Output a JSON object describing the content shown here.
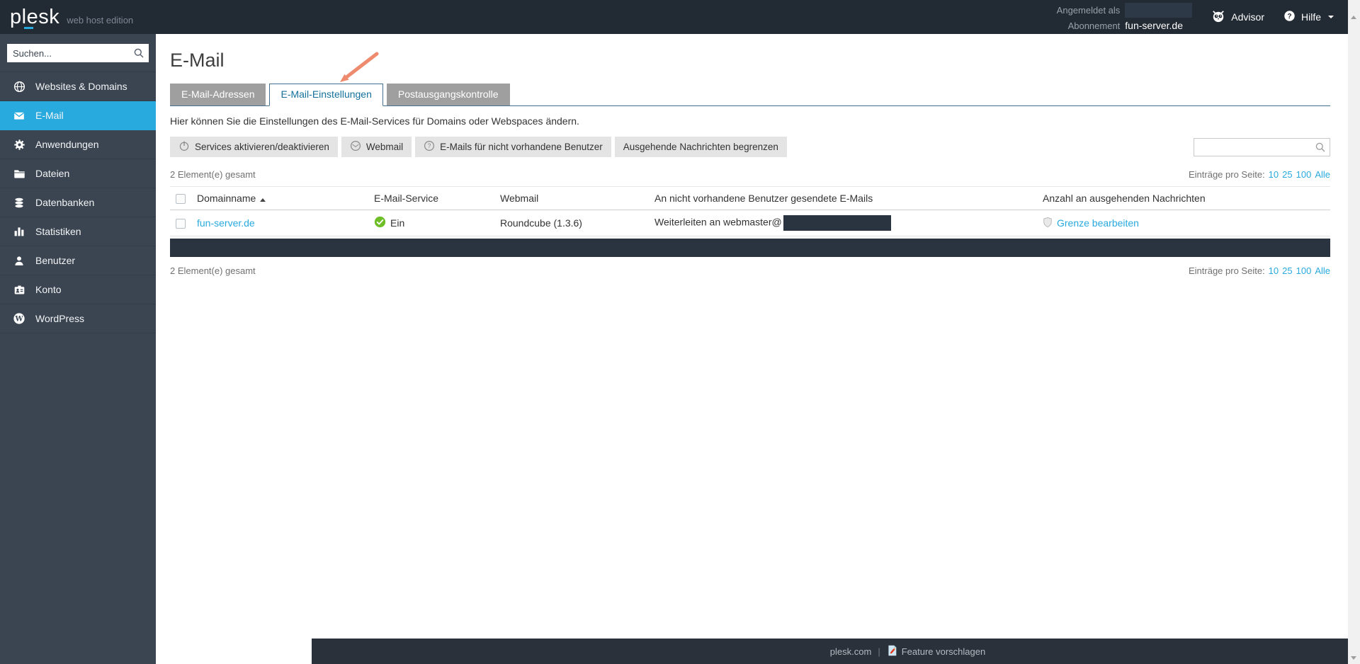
{
  "topbar": {
    "logo": "plesk",
    "edition": "web host edition",
    "logged_in_label": "Angemeldet als",
    "logged_in_value_redacted": true,
    "subscription_label": "Abonnement",
    "subscription_value": "fun-server.de",
    "advisor_label": "Advisor",
    "help_label": "Hilfe"
  },
  "sidebar": {
    "search_placeholder": "Suchen...",
    "items": [
      {
        "label": "Websites & Domains",
        "icon": "globe-icon",
        "active": false
      },
      {
        "label": "E-Mail",
        "icon": "mail-icon",
        "active": true
      },
      {
        "label": "Anwendungen",
        "icon": "gear-icon",
        "active": false
      },
      {
        "label": "Dateien",
        "icon": "folder-icon",
        "active": false
      },
      {
        "label": "Datenbanken",
        "icon": "database-icon",
        "active": false
      },
      {
        "label": "Statistiken",
        "icon": "chart-icon",
        "active": false
      },
      {
        "label": "Benutzer",
        "icon": "user-icon",
        "active": false
      },
      {
        "label": "Konto",
        "icon": "id-card-icon",
        "active": false
      },
      {
        "label": "WordPress",
        "icon": "wordpress-icon",
        "active": false
      }
    ]
  },
  "main": {
    "title": "E-Mail",
    "tabs": [
      {
        "label": "E-Mail-Adressen",
        "active": false
      },
      {
        "label": "E-Mail-Einstellungen",
        "active": true
      },
      {
        "label": "Postausgangskontrolle",
        "active": false
      }
    ],
    "description": "Hier können Sie die Einstellungen des E-Mail-Services für Domains oder Webspaces ändern.",
    "toolbar": {
      "buttons": [
        {
          "label": "Services aktivieren/deaktivieren",
          "icon": "power-icon"
        },
        {
          "label": "Webmail",
          "icon": "webmail-icon"
        },
        {
          "label": "E-Mails für nicht vorhandene Benutzer",
          "icon": "question-icon"
        },
        {
          "label": "Ausgehende Nachrichten begrenzen",
          "icon": ""
        }
      ],
      "search_value": ""
    },
    "list": {
      "total_top": "2 Element(e) gesamt",
      "total_bottom": "2 Element(e) gesamt",
      "per_page_label": "Einträge pro Seite:",
      "per_page_options": [
        "10",
        "25",
        "100",
        "Alle"
      ],
      "columns": [
        "Domainname",
        "E-Mail-Service",
        "Webmail",
        "An nicht vorhandene Benutzer gesendete E-Mails",
        "Anzahl an ausgehenden Nachrichten"
      ],
      "sort_column": "Domainname",
      "sort_direction": "asc",
      "rows": [
        {
          "domain": "fun-server.de",
          "service_status": "Ein",
          "webmail": "Roundcube (1.3.6)",
          "forwarding": "Weiterleiten an webmaster@",
          "forwarding_redacted": true,
          "limit_action": "Grenze bearbeiten"
        },
        {
          "redacted": true
        }
      ]
    }
  },
  "footer": {
    "site_link": "plesk.com",
    "separator": "|",
    "feature_link": "Feature vorschlagen"
  },
  "colors": {
    "accent": "#28aade",
    "topbar_bg": "#222a33",
    "sidebar_bg": "#3b4551",
    "footer_bg": "#2a313a",
    "active_tab_text": "#15719b",
    "tab_border": "#44708f",
    "inactive_tab_bg": "#9f9f9f",
    "status_on_green": "#6ebe28",
    "redaction": "#2a3340",
    "annotation_arrow": "#ee8a6d"
  }
}
